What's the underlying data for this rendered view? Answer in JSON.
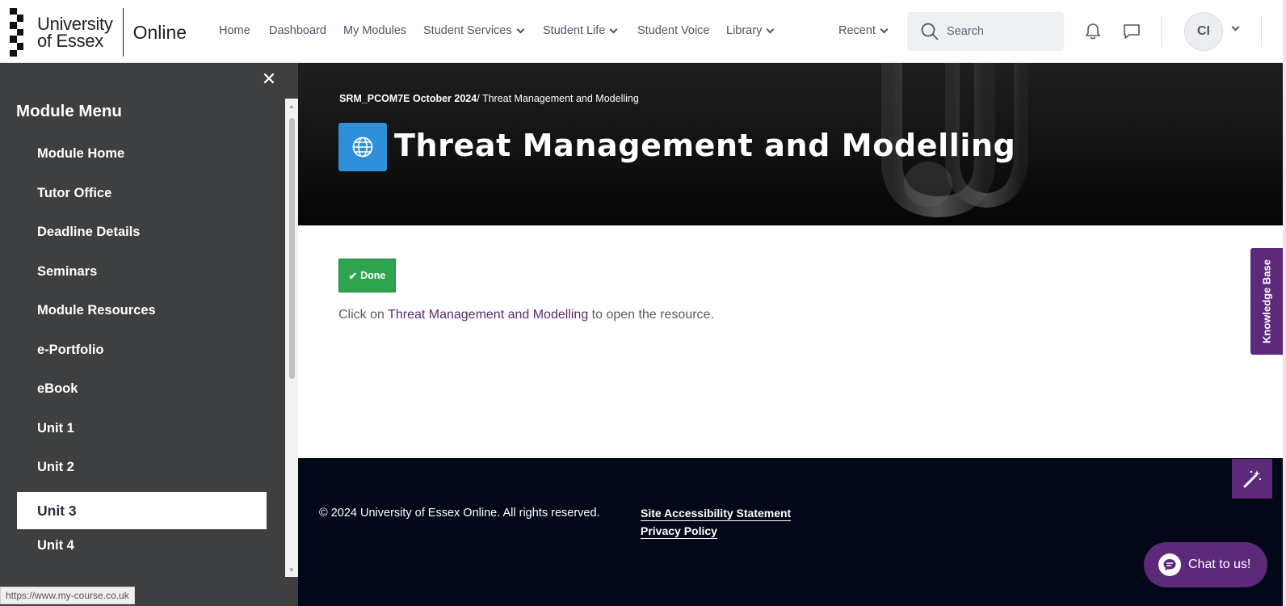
{
  "brand": {
    "name_line1": "University",
    "name_line2": "of Essex",
    "online": "Online"
  },
  "nav": {
    "links": [
      "Home",
      "Dashboard",
      "My Modules",
      "Student Services",
      "Student Life",
      "Student Voice",
      "Library"
    ],
    "recent": "Recent",
    "search_placeholder": "Search",
    "avatar_initials": "CI"
  },
  "sidebar": {
    "title": "Module Menu",
    "items": [
      "Module Home",
      "Tutor Office",
      "Deadline Details",
      "Seminars",
      "Module Resources",
      "e-Portfolio",
      "eBook",
      "Unit 1",
      "Unit 2",
      "Unit 3",
      "Unit 4"
    ],
    "active_item": "Unit 3"
  },
  "banner": {
    "breadcrumb_course": "SRM_PCOM7E October 2024",
    "breadcrumb_sep": "/",
    "breadcrumb_page": "Threat Management and Modelling",
    "title": "Threat Management and Modelling",
    "icon": "globe-icon"
  },
  "content": {
    "done_label": "Done",
    "instruction_prefix": "Click on",
    "instruction_link": "Threat Management and Modelling",
    "instruction_suffix": "to open the resource."
  },
  "side_tabs": {
    "knowledge_base": "Knowledge Base",
    "chat": "Chat to us!"
  },
  "footer": {
    "copyright": "© 2024 University of Essex Online. All rights reserved.",
    "accessibility": "Site Accessibility Statement",
    "privacy": "Privacy Policy"
  },
  "status_bar": {
    "url": "https://www.my-course.co.uk"
  },
  "colors": {
    "brand_purple": "#5d2a7a",
    "done_green": "#2ea44f",
    "sidebar_bg": "#3d3f40",
    "footer_bg": "#030818",
    "globe_blue": "#2f8fd8"
  }
}
